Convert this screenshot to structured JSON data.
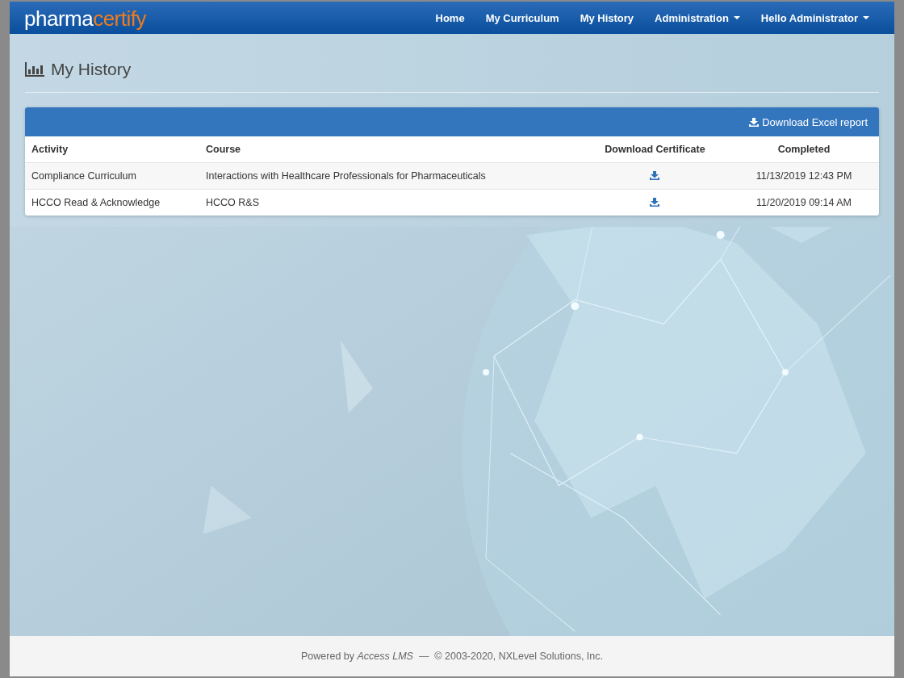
{
  "logo": {
    "prefix": "pharma",
    "suffix": "certify"
  },
  "nav": [
    {
      "label": "Home",
      "dropdown": false
    },
    {
      "label": "My Curriculum",
      "dropdown": false
    },
    {
      "label": "My History",
      "dropdown": false
    },
    {
      "label": "Administration",
      "dropdown": true
    },
    {
      "label": "Hello Administrator",
      "dropdown": true
    }
  ],
  "page_title": "My History",
  "panel": {
    "download_button": "Download Excel report",
    "columns": [
      "Activity",
      "Course",
      "Download Certificate",
      "Completed"
    ],
    "rows": [
      {
        "activity": "Compliance Curriculum",
        "course": "Interactions with Healthcare Professionals for Pharmaceuticals",
        "completed": "11/13/2019 12:43 PM"
      },
      {
        "activity": "HCCO Read & Acknowledge",
        "course": "HCCO R&S",
        "completed": "11/20/2019 09:14 AM"
      }
    ]
  },
  "footer": "Powered by *Access LMS*  —  © 2003-2020, NXLevel Solutions, Inc."
}
